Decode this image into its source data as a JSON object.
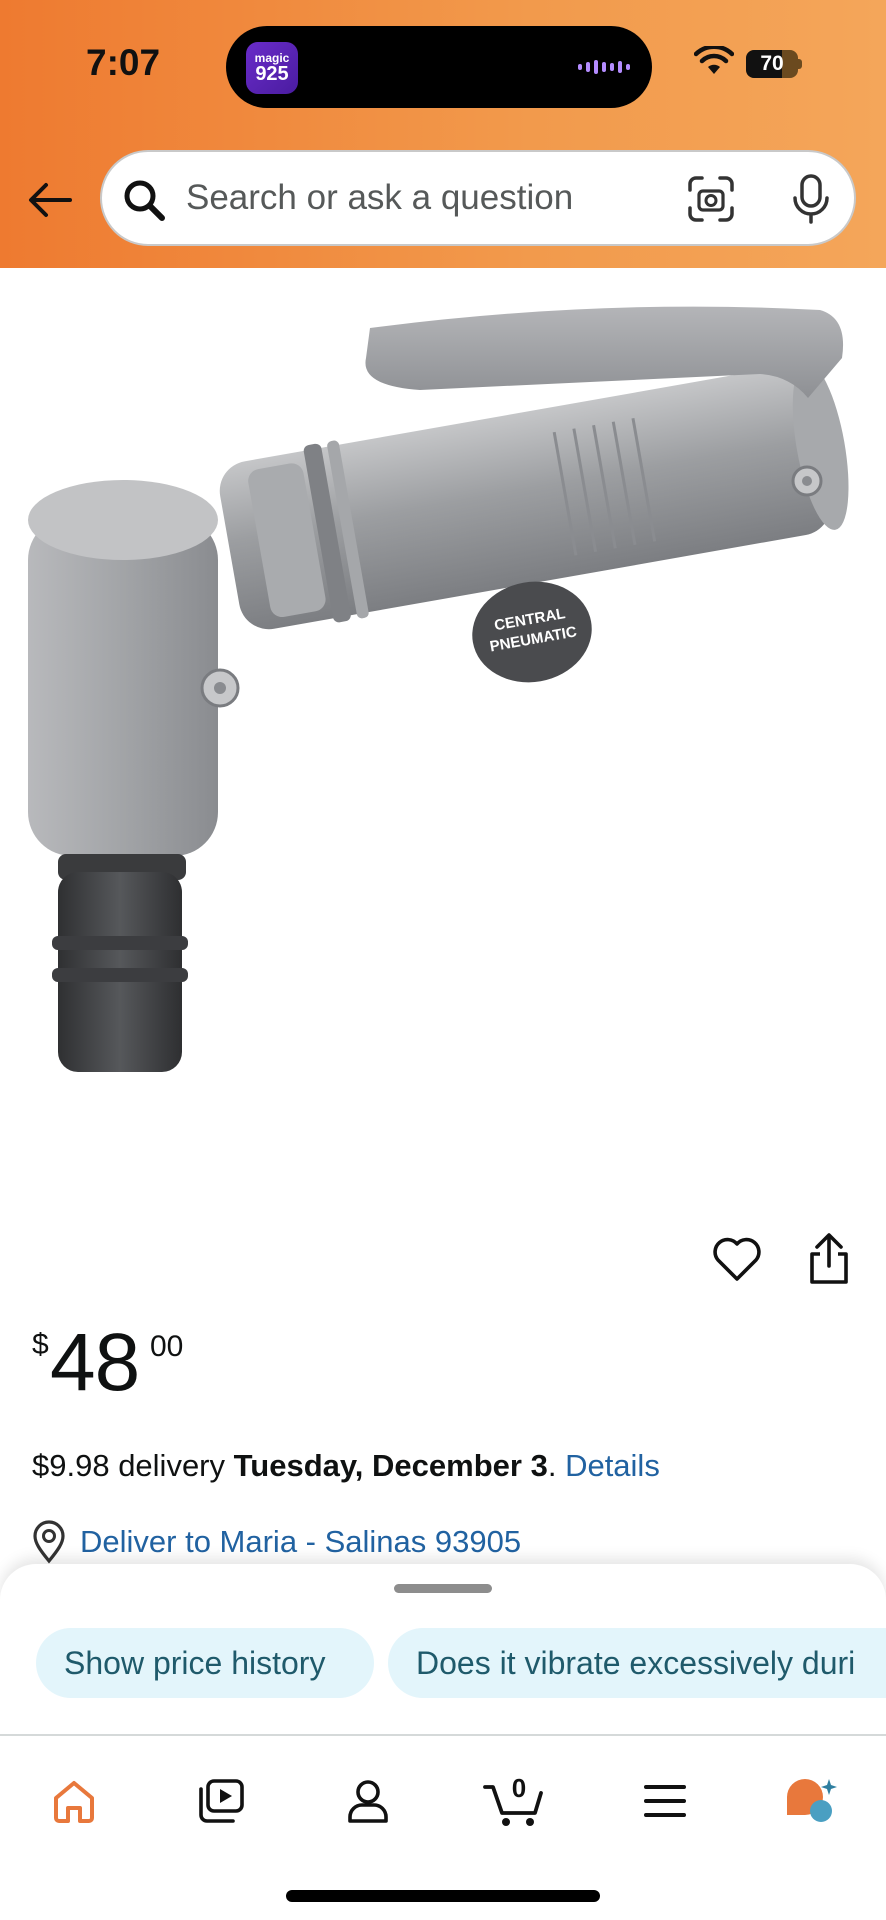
{
  "status_bar": {
    "time": "7:07",
    "island_app_line1": "magic",
    "island_app_line2": "925",
    "battery_level": "70",
    "battery_fraction": 0.7
  },
  "header": {
    "back_icon": "back-arrow-icon",
    "search": {
      "placeholder": "Search or ask a question",
      "value": ""
    },
    "camera_icon": "camera-scan-icon",
    "mic_icon": "microphone-icon"
  },
  "product": {
    "image_alt": "Central Pneumatic angle die grinder",
    "brand_badge_line1": "CENTRAL",
    "brand_badge_line2": "PNEUMATIC",
    "price_symbol": "$",
    "price_whole": "48",
    "price_fraction": "00",
    "delivery_price": "$9.98 delivery",
    "delivery_date": "Tuesday, December 3",
    "delivery_period": ".",
    "details_link": "Details",
    "deliver_to": "Deliver to Maria - Salinas 93905"
  },
  "suggestions": [
    "Show price history",
    "Does it vibrate excessively duri"
  ],
  "tabbar": {
    "items": [
      "home-icon",
      "video-icon",
      "account-icon",
      "cart-icon",
      "menu-icon",
      "rufus-icon"
    ],
    "cart_count": "0",
    "active": "home"
  },
  "colors": {
    "header_gradient_start": "#ee7a30",
    "header_gradient_end": "#f4a65a",
    "link": "#2162a1",
    "chip_bg": "#e3f5fb",
    "active_tab": "#e8783c"
  }
}
